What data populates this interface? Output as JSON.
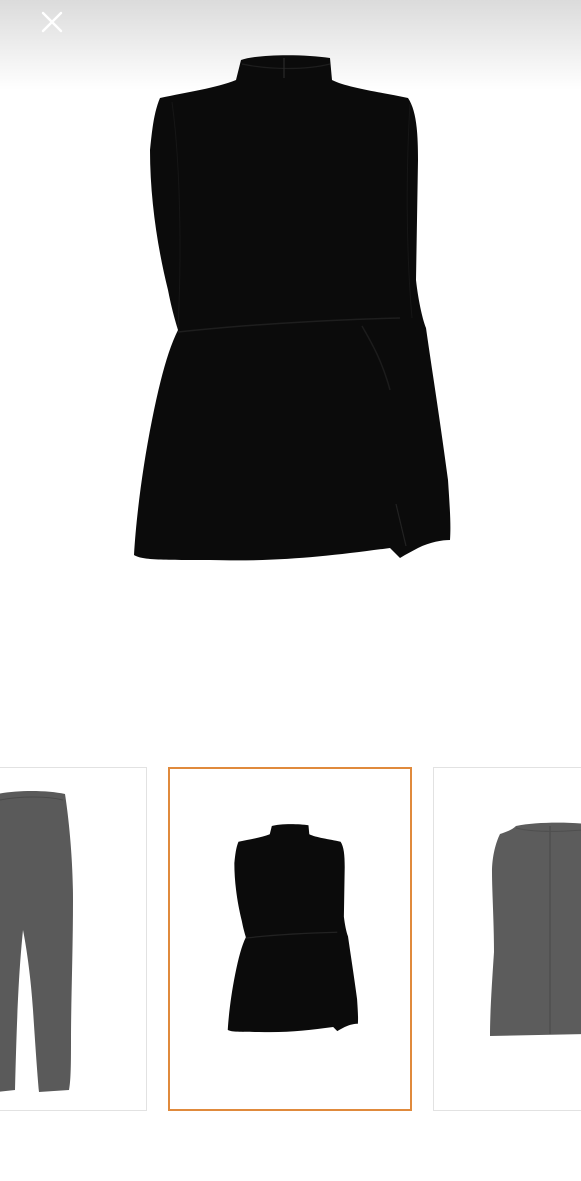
{
  "viewer": {
    "close_icon": "close-icon",
    "close_color": "#ffffff",
    "main_image": {
      "product": "black-sleeveless-mock-neck-top",
      "color": "#0b0b0b"
    }
  },
  "thumbnails": {
    "selected_index": 1,
    "accent_color": "#e08a3c",
    "items": [
      {
        "product": "grey-flared-trousers",
        "color": "#5a5a5a"
      },
      {
        "product": "black-sleeveless-mock-neck-top",
        "color": "#0b0b0b"
      },
      {
        "product": "grey-sleeveless-top-back-view",
        "color": "#5c5c5c"
      }
    ]
  }
}
